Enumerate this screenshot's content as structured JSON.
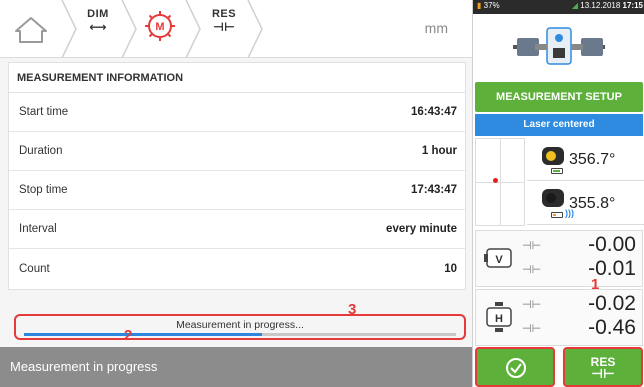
{
  "nav": {
    "home_icon": "home-icon",
    "tabs": [
      {
        "label": "DIM",
        "symbol": "⟷"
      },
      {
        "label": "M",
        "symbol": ""
      },
      {
        "label": "RES",
        "symbol": "⊣⊢"
      }
    ],
    "unit": "mm"
  },
  "info": {
    "header": "MEASUREMENT INFORMATION",
    "rows": [
      {
        "label": "Start time",
        "value": "16:43:47"
      },
      {
        "label": "Duration",
        "value": "1 hour"
      },
      {
        "label": "Stop time",
        "value": "17:43:47"
      },
      {
        "label": "Interval",
        "value": "every minute"
      },
      {
        "label": "Count",
        "value": "10"
      }
    ]
  },
  "progress": {
    "label": "Measurement in progress...",
    "fraction": 0.55
  },
  "markers": {
    "m1": "1",
    "m2": "2",
    "m3": "3"
  },
  "status": {
    "text": "Measurement in progress"
  },
  "sysbar": {
    "battery": "37%",
    "date": "13.12.2018",
    "time": "17:15"
  },
  "right": {
    "setup_button": "MEASUREMENT SETUP",
    "laser_status": "Laser centered",
    "sensors": [
      {
        "value": "356.7°"
      },
      {
        "value": "355.8°"
      }
    ],
    "couplings": [
      {
        "plane": "V",
        "value1": "-0.00",
        "value2": "-0.01"
      },
      {
        "plane": "H",
        "value1": "-0.02",
        "value2": "-0.46"
      }
    ],
    "res_button": {
      "label": "RES",
      "symbol": "⊣⊢"
    }
  },
  "colors": {
    "accent_green": "#5db13a",
    "accent_blue": "#2e8be0",
    "highlight_red": "#e63939",
    "status_gray": "#8c8c8c"
  }
}
